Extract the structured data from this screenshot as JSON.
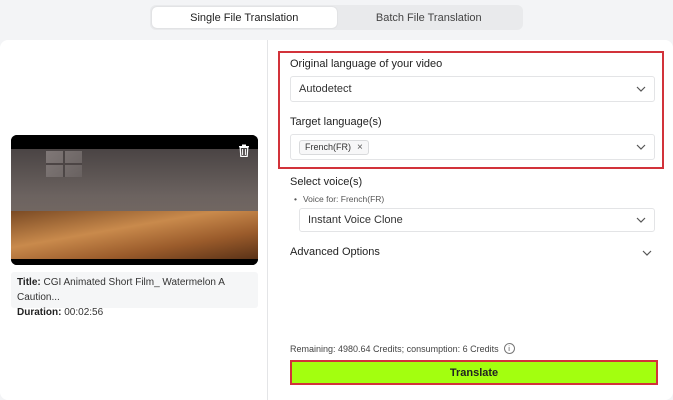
{
  "tabs": [
    {
      "label": "Single File Translation",
      "active": true
    },
    {
      "label": "Batch File Translation",
      "active": false
    }
  ],
  "video": {
    "title_label": "Title:",
    "title": "CGI Animated Short Film_ Watermelon A Caution...",
    "duration_label": "Duration:",
    "duration": "00:02:56",
    "delete_icon": "trash-icon"
  },
  "form": {
    "original_language_label": "Original language of your video",
    "original_language_value": "Autodetect",
    "target_language_label": "Target language(s)",
    "target_languages": [
      "French(FR)"
    ],
    "select_voice_label": "Select voice(s)",
    "voice_for_label": "Voice for: French(FR)",
    "voice_value": "Instant Voice Clone",
    "advanced_options_label": "Advanced Options"
  },
  "footer": {
    "remaining_text": "Remaining: 4980.64 Credits; consumption: 6 Credits",
    "info_icon": "info-icon",
    "translate_label": "Translate"
  },
  "colors": {
    "highlight_border": "#d2323a",
    "translate_bg": "#a3ff0f"
  }
}
